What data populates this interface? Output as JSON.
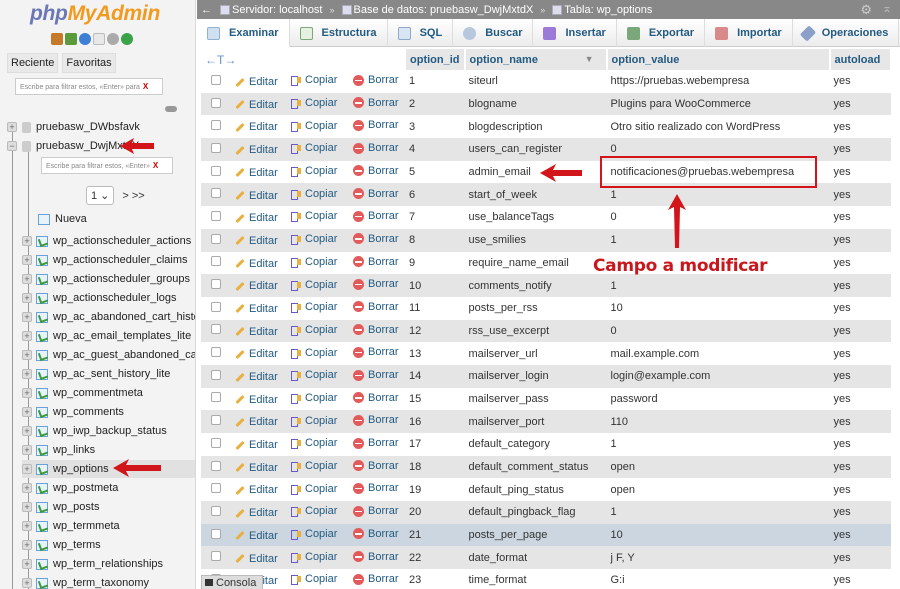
{
  "sidebar": {
    "logo": {
      "part1": "php",
      "part2": "MyAdmin"
    },
    "logo_icons": [
      "home-icon",
      "exit-icon",
      "help-icon",
      "docs-icon",
      "settings-icon",
      "reload-icon"
    ],
    "tabs": [
      "Reciente",
      "Favoritas"
    ],
    "filter_top": {
      "placeholder": "Escribe para filtrar estos, «Enter» para",
      "clear": "X"
    },
    "databases": [
      {
        "name": "pruebasw_DWbsfavk",
        "expanded": false
      },
      {
        "name": "pruebasw_DwjMxtdX",
        "expanded": true
      }
    ],
    "filter_db": {
      "placeholder": "Escribe para filtrar estos, «Enter»",
      "clear": "X"
    },
    "pager": {
      "page": "1",
      "nav": "> >>"
    },
    "new_label": "Nueva",
    "tables": [
      "wp_actionscheduler_actions",
      "wp_actionscheduler_claims",
      "wp_actionscheduler_groups",
      "wp_actionscheduler_logs",
      "wp_ac_abandoned_cart_history",
      "wp_ac_email_templates_lite",
      "wp_ac_guest_abandoned_cart",
      "wp_ac_sent_history_lite",
      "wp_commentmeta",
      "wp_comments",
      "wp_iwp_backup_status",
      "wp_links",
      "wp_options",
      "wp_postmeta",
      "wp_posts",
      "wp_termmeta",
      "wp_terms",
      "wp_term_relationships",
      "wp_term_taxonomy"
    ],
    "selected_table": "wp_options"
  },
  "breadcrumb": {
    "back": "←",
    "server": "Servidor: localhost",
    "database": "Base de datos: pruebasw_DwjMxtdX",
    "table": "Tabla: wp_options",
    "separator": "»"
  },
  "menu": {
    "tabs": [
      {
        "label": "Examinar",
        "icon": "browse-icon",
        "active": true
      },
      {
        "label": "Estructura",
        "icon": "structure-icon"
      },
      {
        "label": "SQL",
        "icon": "sql-icon"
      },
      {
        "label": "Buscar",
        "icon": "search-icon"
      },
      {
        "label": "Insertar",
        "icon": "insert-icon"
      },
      {
        "label": "Exportar",
        "icon": "export-icon"
      },
      {
        "label": "Importar",
        "icon": "import-icon"
      },
      {
        "label": "Operaciones",
        "icon": "operations-icon"
      }
    ],
    "more": "▼"
  },
  "table": {
    "arrows": "←T→",
    "columns": [
      "option_id",
      "option_name",
      "option_value",
      "autoload"
    ],
    "sort_indicator": "▼",
    "actions": {
      "edit": "Editar",
      "copy": "Copiar",
      "delete": "Borrar"
    },
    "rows": [
      {
        "id": "1",
        "name": "siteurl",
        "value": "https://pruebas.webempresa",
        "autoload": "yes"
      },
      {
        "id": "2",
        "name": "blogname",
        "value": "Plugins para WooCommerce",
        "autoload": "yes"
      },
      {
        "id": "3",
        "name": "blogdescription",
        "value": "Otro sitio realizado con WordPress",
        "autoload": "yes"
      },
      {
        "id": "4",
        "name": "users_can_register",
        "value": "0",
        "autoload": "yes"
      },
      {
        "id": "5",
        "name": "admin_email",
        "value": "notificaciones@pruebas.webempresa",
        "autoload": "yes"
      },
      {
        "id": "6",
        "name": "start_of_week",
        "value": "1",
        "autoload": "yes"
      },
      {
        "id": "7",
        "name": "use_balanceTags",
        "value": "0",
        "autoload": "yes"
      },
      {
        "id": "8",
        "name": "use_smilies",
        "value": "1",
        "autoload": "yes"
      },
      {
        "id": "9",
        "name": "require_name_email",
        "value": "",
        "autoload": "yes"
      },
      {
        "id": "10",
        "name": "comments_notify",
        "value": "1",
        "autoload": "yes"
      },
      {
        "id": "11",
        "name": "posts_per_rss",
        "value": "10",
        "autoload": "yes"
      },
      {
        "id": "12",
        "name": "rss_use_excerpt",
        "value": "0",
        "autoload": "yes"
      },
      {
        "id": "13",
        "name": "mailserver_url",
        "value": "mail.example.com",
        "autoload": "yes"
      },
      {
        "id": "14",
        "name": "mailserver_login",
        "value": "login@example.com",
        "autoload": "yes"
      },
      {
        "id": "15",
        "name": "mailserver_pass",
        "value": "password",
        "autoload": "yes"
      },
      {
        "id": "16",
        "name": "mailserver_port",
        "value": "110",
        "autoload": "yes"
      },
      {
        "id": "17",
        "name": "default_category",
        "value": "1",
        "autoload": "yes"
      },
      {
        "id": "18",
        "name": "default_comment_status",
        "value": "open",
        "autoload": "yes"
      },
      {
        "id": "19",
        "name": "default_ping_status",
        "value": "open",
        "autoload": "yes"
      },
      {
        "id": "20",
        "name": "default_pingback_flag",
        "value": "1",
        "autoload": "yes"
      },
      {
        "id": "21",
        "name": "posts_per_page",
        "value": "10",
        "autoload": "yes",
        "highlighted": true
      },
      {
        "id": "22",
        "name": "date_format",
        "value": "j F, Y",
        "autoload": "yes"
      },
      {
        "id": "23",
        "name": "time_format",
        "value": "G:i",
        "autoload": "yes"
      }
    ]
  },
  "annotation": {
    "label": "Campo a modificar",
    "color": "#d2151b"
  },
  "console": {
    "label": "Consola"
  },
  "colors": {
    "link": "#235a81",
    "topbar": "#888888",
    "row_alt": "#e5e5e5",
    "row_highlight": "#ccd6e0"
  }
}
